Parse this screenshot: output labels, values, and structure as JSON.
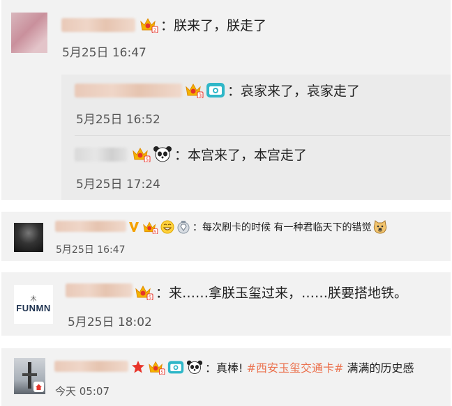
{
  "comments": [
    {
      "text": "朕来了，朕走了",
      "time": "5月25日 16:47"
    },
    {
      "text": "哀家来了，哀家走了",
      "time": "5月25日 16:52"
    },
    {
      "text": "本宫来了，本宫走了",
      "time": "5月25日 17:24"
    },
    {
      "text": "每次刷卡的时候 有一种君临天下的错觉",
      "time": "5月25日 16:47"
    },
    {
      "text": "来……拿朕玉玺过来，……朕要搭地铁。",
      "time": "5月25日 18:02",
      "avatar_text": "FUNMN"
    },
    {
      "text_before": "真棒! ",
      "hashtag": "#西安玉玺交通卡#",
      "text_after": " 满满的历史感",
      "time": "今天 05:07"
    }
  ],
  "separator": "：",
  "icons": [
    "vip-crown-icon",
    "camera-badge-icon",
    "panda-icon",
    "verified-v-icon",
    "grin-emoji-icon",
    "diamond-medal-icon",
    "doge-emoji-icon",
    "star-icon"
  ],
  "colors": {
    "card_bg": "#f2f2f2",
    "reply_bg": "#ebebeb",
    "hashtag": "#eb7350",
    "verified": "#f4a100",
    "star": "#e8352b"
  }
}
